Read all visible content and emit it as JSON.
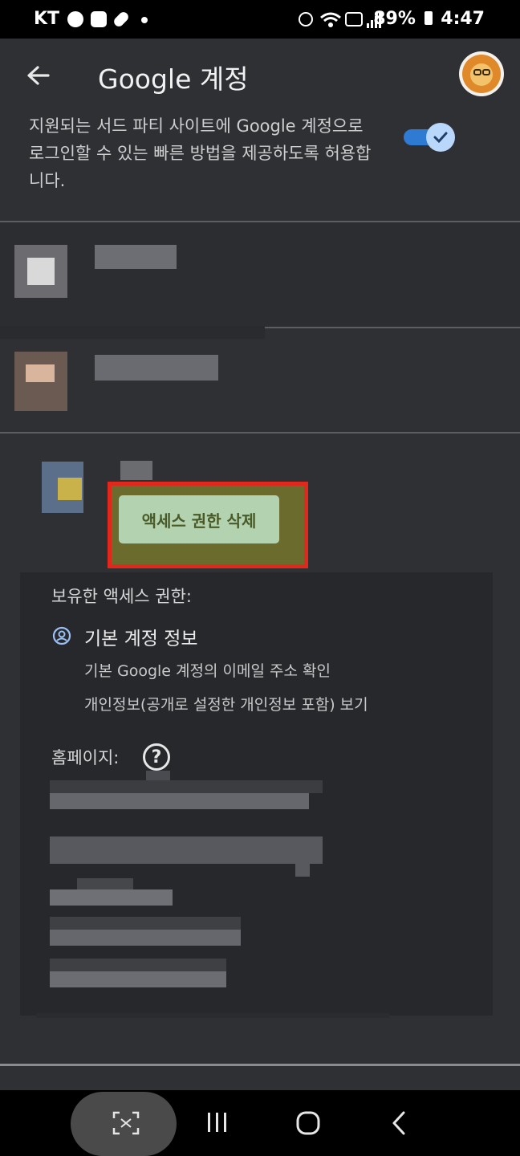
{
  "status_bar": {
    "carrier": "KT",
    "battery": "89%",
    "time": "4:47",
    "icons": [
      "kakaotalk-icon",
      "gallery-icon",
      "pill-icon",
      "dot-icon",
      "android-icon",
      "wifi-icon",
      "hd-icon",
      "signal-icon",
      "battery-icon"
    ]
  },
  "app_bar": {
    "title": "Google 계정",
    "back_icon": "arrow-left-icon",
    "avatar": "lion-avatar"
  },
  "intro": {
    "text": "지원되는 서드 파티 사이트에 Google 계정으로 로그인할 수 있는 빠른 방법을 제공하도록 허용합니다.",
    "toggle_on": true
  },
  "popup": {
    "remove_access_label": "액세스 권한 삭제"
  },
  "detail": {
    "access_heading": "보유한 액세스 권한:",
    "basic_title": "기본 계정 정보",
    "lines": [
      "기본 Google 계정의 이메일 주소 확인",
      "개인정보(공개로 설정한 개인정보 포함) 보기"
    ],
    "homepage_label": "홈페이지:",
    "help_symbol": "?"
  },
  "nav_bar": {
    "icons": [
      "screen-capture-icon",
      "recent-apps-icon",
      "home-icon",
      "back-icon"
    ]
  },
  "colors": {
    "accent_toggle": "#2f7bd4",
    "highlight_border": "#e2281c",
    "button_bg": "#b3d2b0"
  }
}
